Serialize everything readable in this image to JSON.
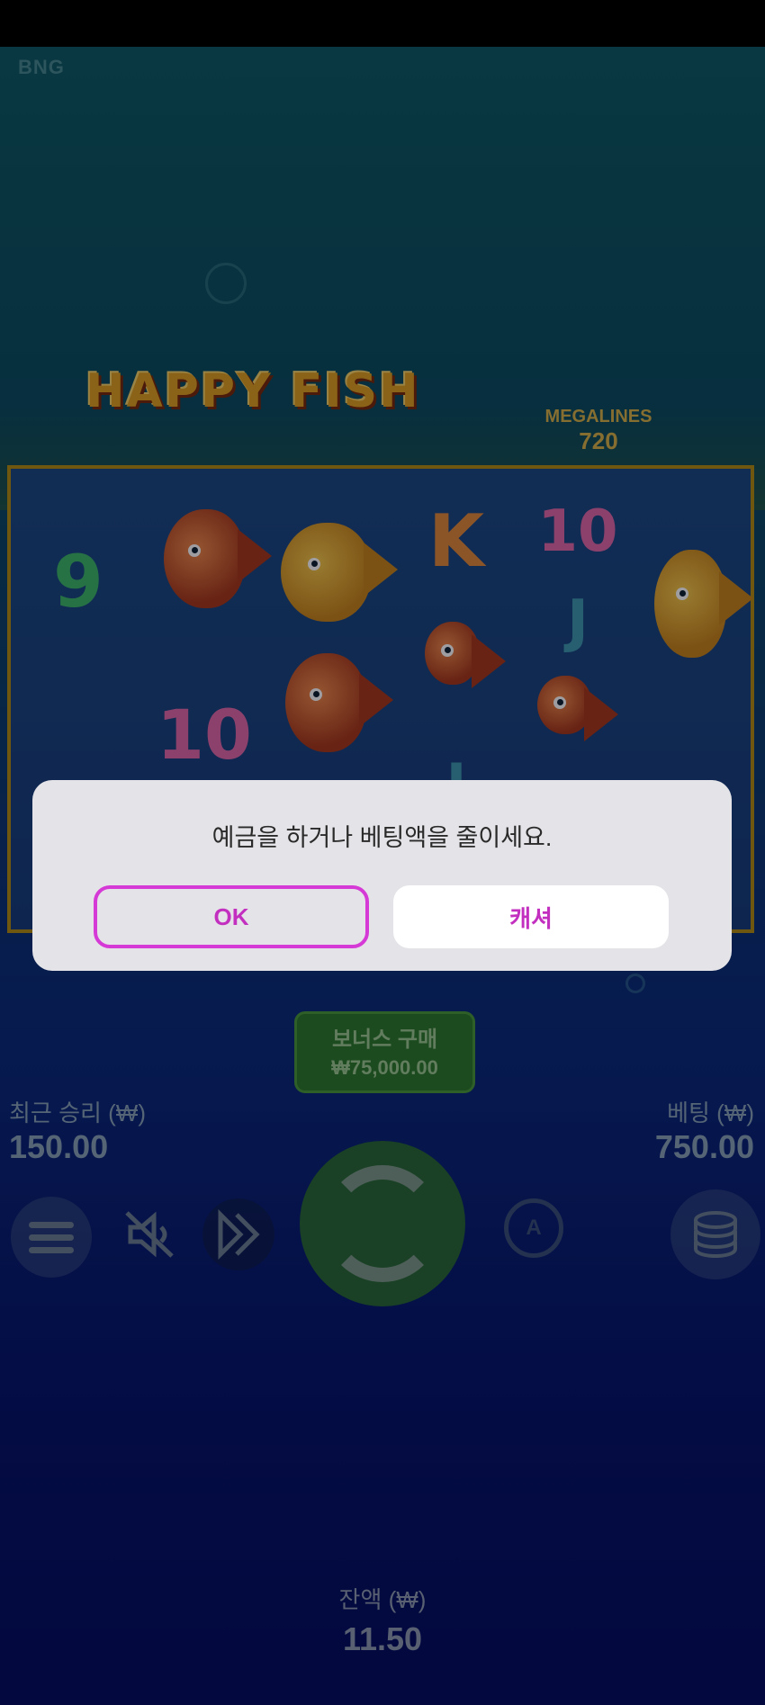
{
  "game": {
    "provider": "BNG",
    "logo_text": "HAPPY FISH",
    "megalines_label": "MEGALINES",
    "megalines_value": "720",
    "reels": [
      [
        "9",
        "",
        ""
      ],
      [
        "fish-red",
        "10",
        ""
      ],
      [
        "fish-gold",
        "fish-red",
        ""
      ],
      [
        "K",
        "fish-small",
        "J"
      ],
      [
        "10",
        "J",
        "fish-small"
      ],
      [
        "fish-gold",
        "",
        ""
      ]
    ],
    "bonus_buy_label": "보너스 구매",
    "bonus_buy_price": "₩75,000.00",
    "last_win_label": "최근 승리 (₩)",
    "last_win_value": "150.00",
    "bet_label": "베팅 (₩)",
    "bet_value": "750.00",
    "balance_label": "잔액 (₩)",
    "balance_value": "11.50",
    "controls": [
      "menu-icon",
      "mute-icon",
      "fast-forward-icon",
      "spin-icon",
      "autoplay-icon",
      "coins-icon"
    ]
  },
  "dialog": {
    "message": "예금을 하거나 베팅액을 줄이세요.",
    "ok_label": "OK",
    "cashier_label": "캐셔"
  },
  "colors": {
    "accent": "#c330c0",
    "ok_border": "#d63ad6",
    "dialog_bg": "#e4e4e8"
  }
}
